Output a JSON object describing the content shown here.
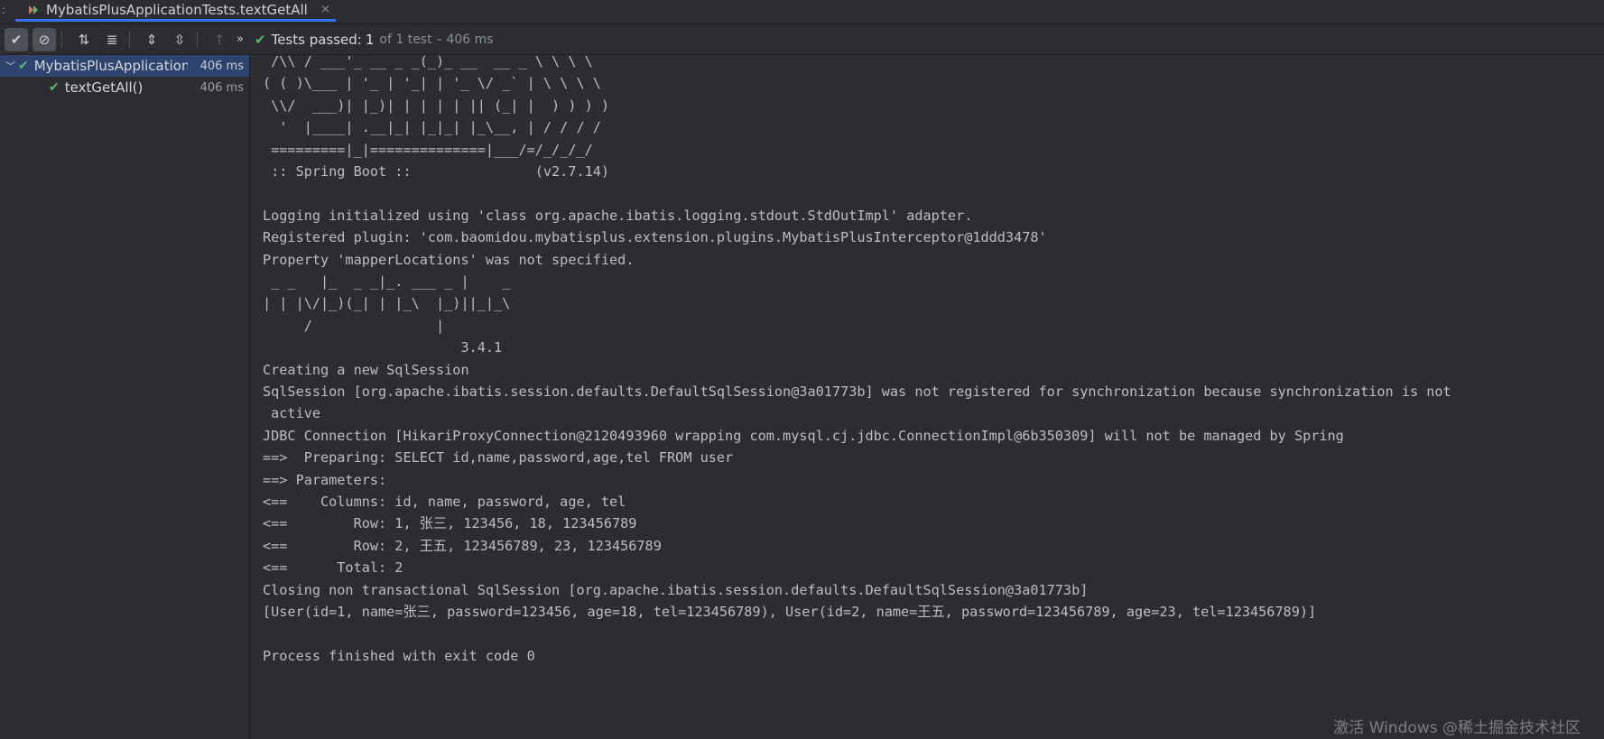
{
  "tab": {
    "title": "MybatisPlusApplicationTests.textGetAll",
    "close": "×",
    "left_dots": ":"
  },
  "toolbar": {
    "status_prefix": "Tests passed:",
    "status_count": "1",
    "status_rest": "of 1 test – 406 ms"
  },
  "tree": {
    "root": {
      "label": "MybatisPlusApplicationTests",
      "duration": "406 ms"
    },
    "child": {
      "label": "textGetAll()",
      "duration": "406 ms"
    }
  },
  "console": {
    "lines": [
      " /\\\\ / ___'_ __ _ _(_)_ __  __ _ \\ \\ \\ \\",
      "( ( )\\___ | '_ | '_| | '_ \\/ _` | \\ \\ \\ \\",
      " \\\\/  ___)| |_)| | | | | || (_| |  ) ) ) )",
      "  '  |____| .__|_| |_|_| |_\\__, | / / / /",
      " =========|_|==============|___/=/_/_/_/",
      " :: Spring Boot ::               (v2.7.14)",
      "",
      "Logging initialized using 'class org.apache.ibatis.logging.stdout.StdOutImpl' adapter.",
      "Registered plugin: 'com.baomidou.mybatisplus.extension.plugins.MybatisPlusInterceptor@1ddd3478'",
      "Property 'mapperLocations' was not specified.",
      " _ _   |_  _ _|_. ___ _ |    _",
      "| | |\\/|_)(_| | |_\\  |_)||_|_\\",
      "     /               |",
      "                        3.4.1",
      "Creating a new SqlSession",
      "SqlSession [org.apache.ibatis.session.defaults.DefaultSqlSession@3a01773b] was not registered for synchronization because synchronization is not",
      " active",
      "JDBC Connection [HikariProxyConnection@2120493960 wrapping com.mysql.cj.jdbc.ConnectionImpl@6b350309] will not be managed by Spring",
      "==>  Preparing: SELECT id,name,password,age,tel FROM user",
      "==> Parameters: ",
      "<==    Columns: id, name, password, age, tel",
      "<==        Row: 1, 张三, 123456, 18, 123456789",
      "<==        Row: 2, 王五, 123456789, 23, 123456789",
      "<==      Total: 2",
      "Closing non transactional SqlSession [org.apache.ibatis.session.defaults.DefaultSqlSession@3a01773b]",
      "[User(id=1, name=张三, password=123456, age=18, tel=123456789), User(id=2, name=王五, password=123456789, age=23, tel=123456789)]",
      "",
      "Process finished with exit code 0"
    ]
  },
  "watermark": "激活 Windows  @稀土掘金技术社区",
  "colors": {
    "accent": "#3574f0",
    "success": "#5fb865",
    "selection": "#2e436e",
    "background": "#2b2d30"
  }
}
